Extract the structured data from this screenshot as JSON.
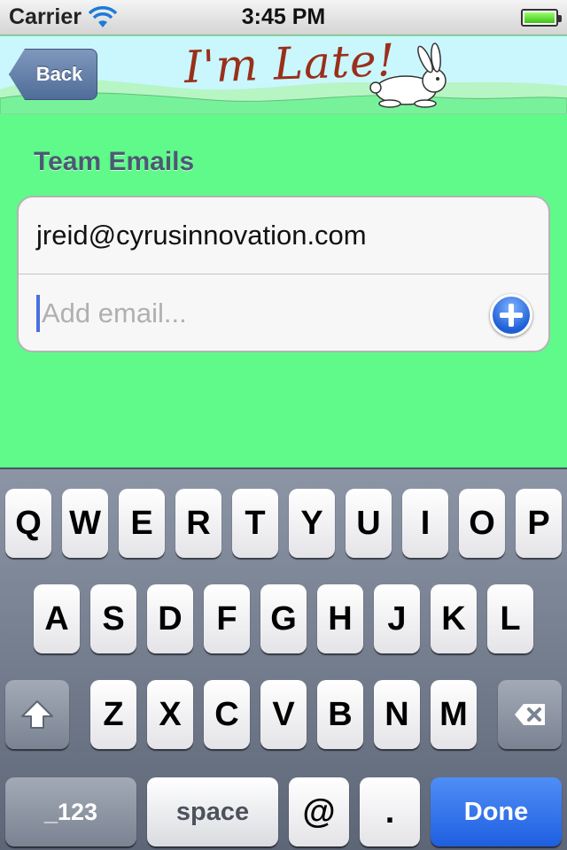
{
  "status_bar": {
    "carrier": "Carrier",
    "time": "3:45 PM",
    "battery_level": 1.0,
    "icons": [
      "wifi-icon",
      "battery-icon"
    ]
  },
  "nav": {
    "back_label": "Back",
    "logo_text": "I'm Late!",
    "logo_color": "#9a2f1a",
    "icons": [
      "rabbit-icon"
    ]
  },
  "main": {
    "section_title": "Team Emails",
    "emails": [
      "jreid@cyrusinnovation.com"
    ],
    "add_email": {
      "value": "",
      "placeholder": "Add email..."
    },
    "add_button_icon": "plus-icon"
  },
  "keyboard": {
    "row1": [
      "Q",
      "W",
      "E",
      "R",
      "T",
      "Y",
      "U",
      "I",
      "O",
      "P"
    ],
    "row2": [
      "A",
      "S",
      "D",
      "F",
      "G",
      "H",
      "J",
      "K",
      "L"
    ],
    "row3": [
      "Z",
      "X",
      "C",
      "V",
      "B",
      "N",
      "M"
    ],
    "shift_icon": "shift-icon",
    "delete_icon": "delete-icon",
    "numbers_label": "_123",
    "space_label": "space",
    "at_label": "@",
    "dot_label": ".",
    "done_label": "Done",
    "done_color": "#1f5fe0"
  },
  "colors": {
    "background": "#5ffa8a",
    "section_title": "#4b5a70"
  }
}
